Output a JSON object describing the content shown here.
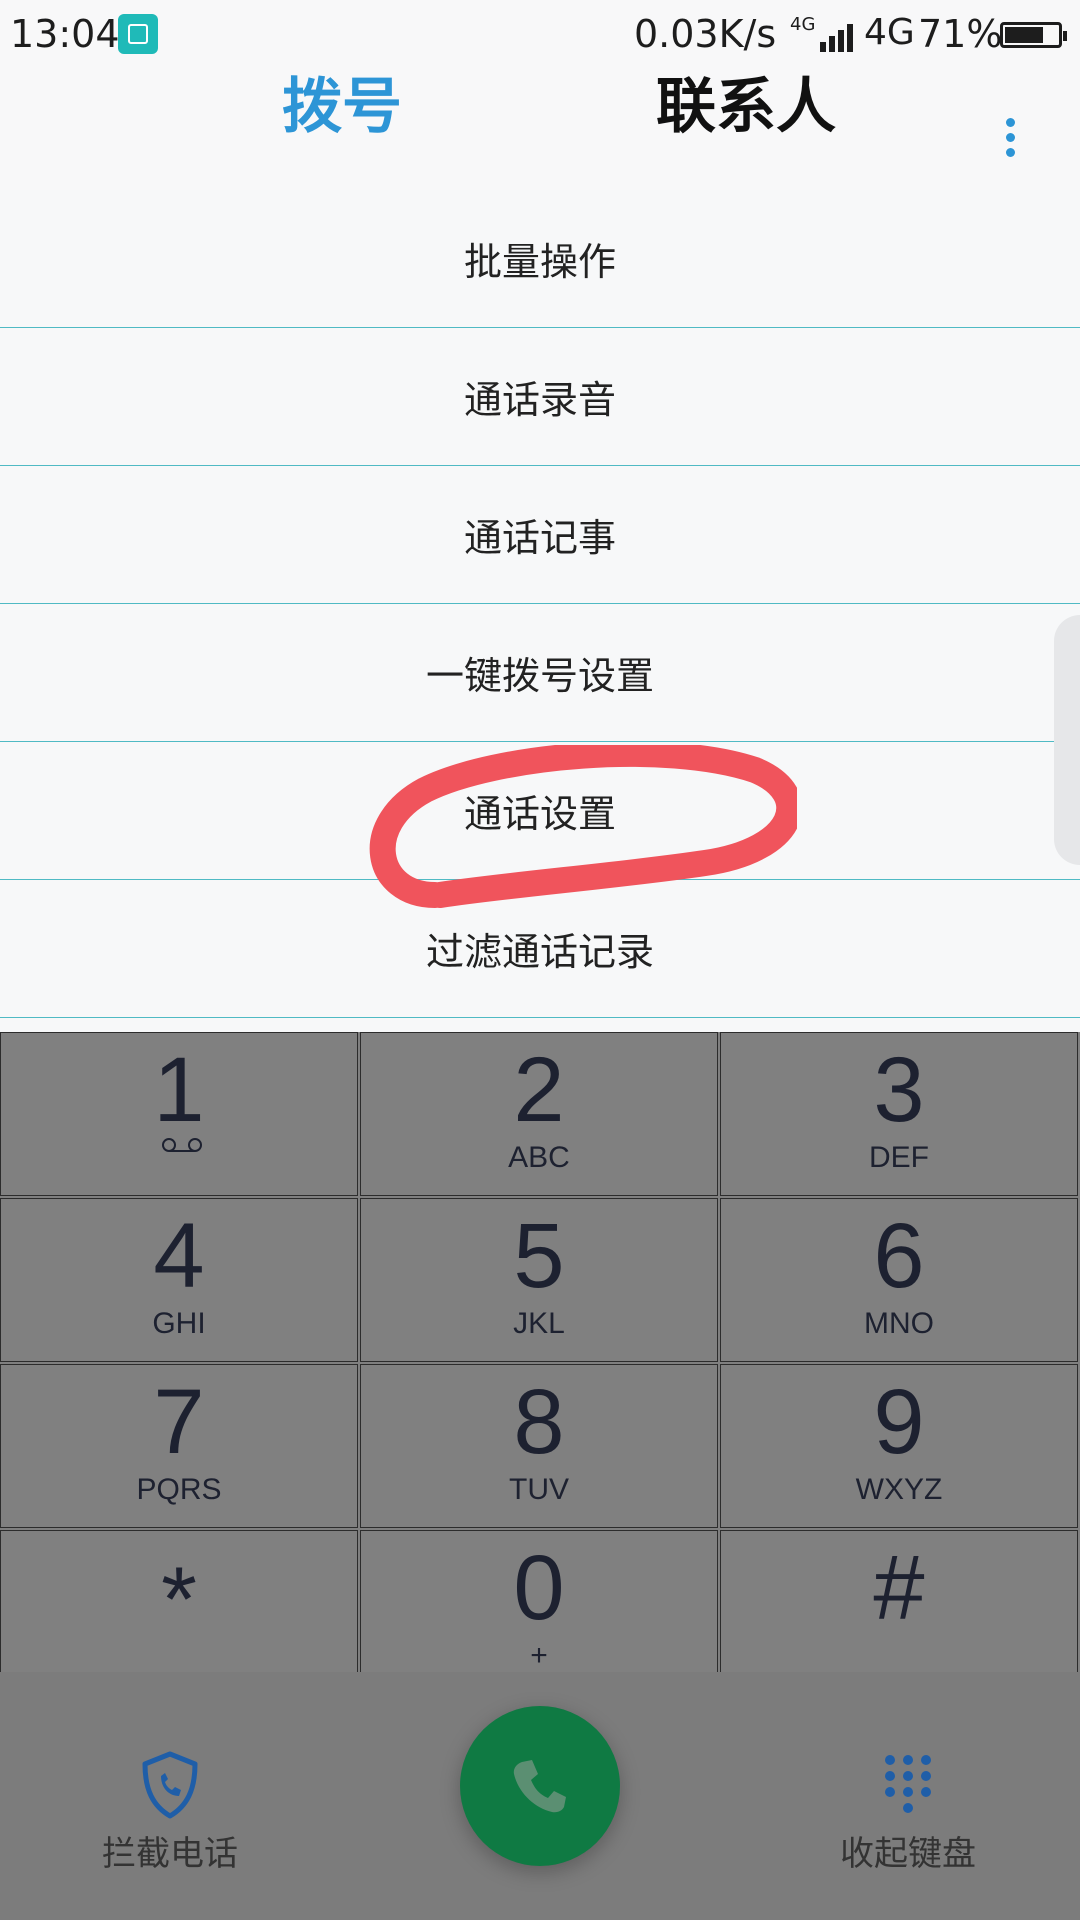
{
  "status_bar": {
    "time": "13:04",
    "speed": "0.03K/s",
    "net_small": "4G",
    "net": "4G",
    "battery": "71%"
  },
  "tabs": {
    "dial": "拨号",
    "contacts": "联系人"
  },
  "menu": {
    "items": [
      "批量操作",
      "通话录音",
      "通话记事",
      "一键拨号设置",
      "通话设置",
      "过滤通话记录"
    ]
  },
  "keypad": {
    "keys": [
      {
        "digit": "1",
        "letters": ""
      },
      {
        "digit": "2",
        "letters": "ABC"
      },
      {
        "digit": "3",
        "letters": "DEF"
      },
      {
        "digit": "4",
        "letters": "GHI"
      },
      {
        "digit": "5",
        "letters": "JKL"
      },
      {
        "digit": "6",
        "letters": "MNO"
      },
      {
        "digit": "7",
        "letters": "PQRS"
      },
      {
        "digit": "8",
        "letters": "TUV"
      },
      {
        "digit": "9",
        "letters": "WXYZ"
      },
      {
        "digit": "*",
        "letters": ""
      },
      {
        "digit": "0",
        "letters": "+"
      },
      {
        "digit": "#",
        "letters": ""
      }
    ]
  },
  "bottom": {
    "block_calls": "拦截电话",
    "hide_keypad": "收起键盘"
  },
  "colors": {
    "accent": "#2d95d6",
    "call": "#0f7a43",
    "highlight": "#f0545c"
  }
}
